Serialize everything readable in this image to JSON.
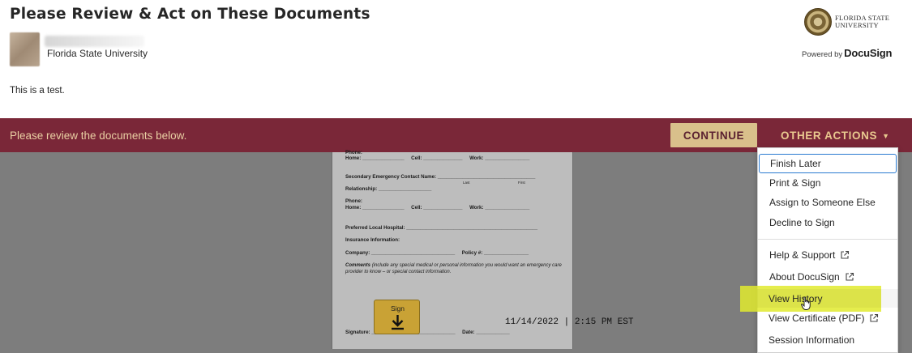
{
  "header": {
    "title": "Please Review & Act on These Documents",
    "sender_org": "Florida State University",
    "message": "This is a test.",
    "logo_text_line1": "FLORIDA STATE",
    "logo_text_line2": "UNIVERSITY",
    "powered_by": "Powered by",
    "powered_brand": "DocuSign"
  },
  "action_bar": {
    "text": "Please review the documents below.",
    "continue_label": "CONTINUE",
    "other_actions_label": "OTHER ACTIONS",
    "bar_color": "#7a2738",
    "continue_color": "#d9c08b"
  },
  "document": {
    "lines": [
      "Phone:",
      "Home: _______________     Cell: ______________     Work: ________________",
      "Secondary Emergency Contact Name: ___________________________________",
      "Relationship: ___________________",
      "Phone:",
      "Home: _______________     Cell: ______________     Work: ________________",
      "Preferred Local Hospital: _______________________________________________",
      "Insurance Information:",
      "Company: ______________________________     Policy #: ________________",
      "Signature: ______________________________     Date: ____________"
    ],
    "sub_last": "Last",
    "sub_first": "First",
    "comments_label": "Comments",
    "comments_text": "(include any special medical or personal information you would want an emergency care provider to know – or special contact information.",
    "sign_label": "Sign",
    "signed_stamp": "11/14/2022 | 2:15 PM EST"
  },
  "dropdown": {
    "items": [
      {
        "label": "Finish Later",
        "external": false
      },
      {
        "label": "Print & Sign",
        "external": false
      },
      {
        "label": "Assign to Someone Else",
        "external": false
      },
      {
        "label": "Decline to Sign",
        "external": false
      },
      {
        "label": "Help & Support",
        "external": true
      },
      {
        "label": "About DocuSign",
        "external": true
      },
      {
        "label": "View History",
        "external": false
      },
      {
        "label": "View Certificate (PDF)",
        "external": true
      },
      {
        "label": "Session Information",
        "external": false
      }
    ],
    "highlight_color": "#e0ea2e"
  },
  "icons": {
    "avatar": "avatar",
    "seal": "university-seal-icon",
    "caret": "caret-down-icon",
    "external": "external-link-icon",
    "sign_arrow": "download-arrow-icon",
    "cursor": "hand-cursor-icon"
  }
}
